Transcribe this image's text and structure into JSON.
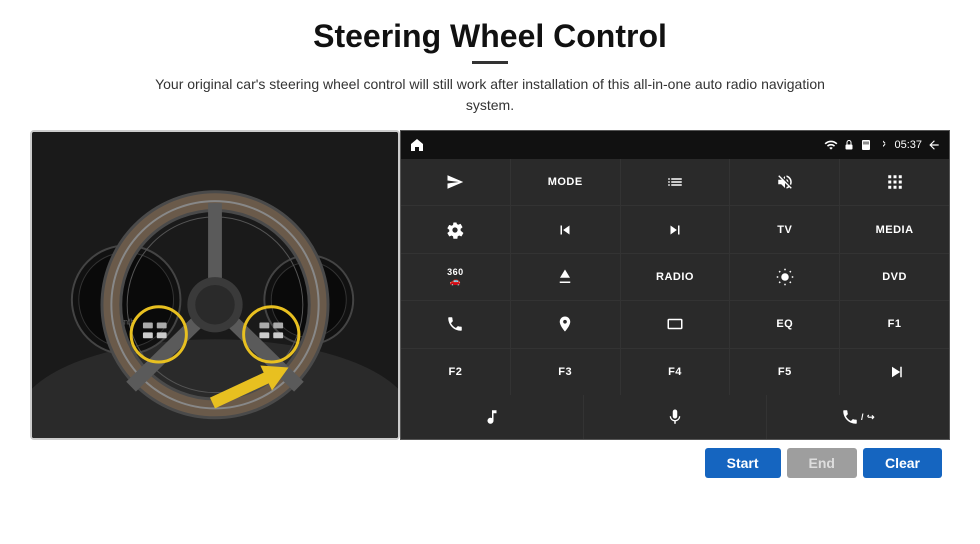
{
  "header": {
    "title": "Steering Wheel Control",
    "subtitle": "Your original car's steering wheel control will still work after installation of this all-in-one auto radio navigation system."
  },
  "status_bar": {
    "time": "05:37",
    "wifi_icon": "wifi",
    "lock_icon": "lock",
    "sd_icon": "sd",
    "bt_icon": "bluetooth",
    "home_icon": "home",
    "back_icon": "back"
  },
  "grid_buttons": [
    {
      "label": "",
      "icon": "send"
    },
    {
      "label": "MODE",
      "icon": ""
    },
    {
      "label": "",
      "icon": "list"
    },
    {
      "label": "",
      "icon": "volume-mute"
    },
    {
      "label": "",
      "icon": "grid"
    },
    {
      "label": "",
      "icon": "settings"
    },
    {
      "label": "",
      "icon": "skip-back"
    },
    {
      "label": "",
      "icon": "skip-forward"
    },
    {
      "label": "TV",
      "icon": ""
    },
    {
      "label": "MEDIA",
      "icon": ""
    },
    {
      "label": "",
      "icon": "360cam"
    },
    {
      "label": "",
      "icon": "eject"
    },
    {
      "label": "RADIO",
      "icon": ""
    },
    {
      "label": "",
      "icon": "brightness"
    },
    {
      "label": "DVD",
      "icon": ""
    },
    {
      "label": "",
      "icon": "phone"
    },
    {
      "label": "",
      "icon": "navi"
    },
    {
      "label": "",
      "icon": "rectangle"
    },
    {
      "label": "EQ",
      "icon": ""
    },
    {
      "label": "F1",
      "icon": ""
    },
    {
      "label": "F2",
      "icon": ""
    },
    {
      "label": "F3",
      "icon": ""
    },
    {
      "label": "F4",
      "icon": ""
    },
    {
      "label": "F5",
      "icon": ""
    },
    {
      "label": "",
      "icon": "play-pause"
    }
  ],
  "last_row": [
    {
      "label": "",
      "icon": "music"
    },
    {
      "label": "",
      "icon": "microphone"
    },
    {
      "label": "",
      "icon": "phone-call"
    }
  ],
  "bottom_buttons": {
    "start": "Start",
    "end": "End",
    "clear": "Clear"
  }
}
